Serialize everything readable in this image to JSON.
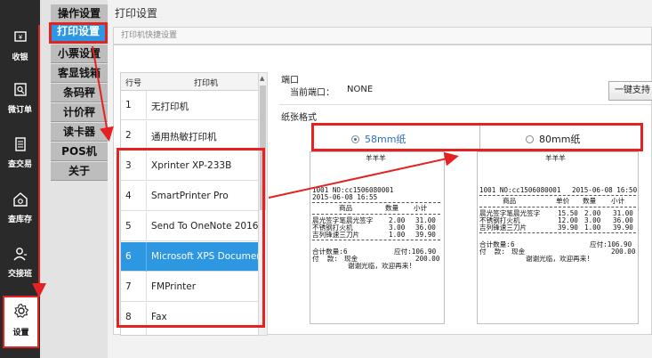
{
  "rail": {
    "items": [
      {
        "label": "收银",
        "icon": "cashier-icon"
      },
      {
        "label": "微订单",
        "icon": "order-icon"
      },
      {
        "label": "查交易",
        "icon": "transaction-icon"
      },
      {
        "label": "查库存",
        "icon": "inventory-icon"
      },
      {
        "label": "交接班",
        "icon": "shift-icon"
      },
      {
        "label": "设置",
        "icon": "gear-icon"
      }
    ]
  },
  "tabs": [
    "操作设置",
    "打印设置",
    "小票设置",
    "客显钱箱",
    "条码秤",
    "计价秤",
    "读卡器",
    "POS机",
    "关于"
  ],
  "main": {
    "title": "打印设置",
    "section": "打印机快捷设置",
    "table": {
      "col_num": "行号",
      "col_printer": "打印机",
      "rows": [
        {
          "num": "1",
          "name": "无打印机"
        },
        {
          "num": "2",
          "name": "通用热敏打印机"
        },
        {
          "num": "3",
          "name": "Xprinter XP-233B"
        },
        {
          "num": "4",
          "name": "SmartPrinter Pro"
        },
        {
          "num": "5",
          "name": "Send To OneNote 2016"
        },
        {
          "num": "6",
          "name": "Microsoft XPS Document"
        },
        {
          "num": "7",
          "name": "FMPrinter"
        },
        {
          "num": "8",
          "name": "Fax"
        }
      ],
      "selected": 6
    },
    "port": {
      "label": "端口",
      "current_label": "当前端口：",
      "current_value": "NONE",
      "button": "一键支持"
    },
    "paper": {
      "label": "纸张格式",
      "opt58": "58mm纸",
      "opt80": "80mm纸",
      "selected": "58mm"
    },
    "receipt58": {
      "store": "羊羊羊",
      "order_line": "1001 NO:cc1506080001",
      "date": "2015-06-08 16:55",
      "head_goods": "商品",
      "head_qty": "数量",
      "head_sub": "小计",
      "items": [
        {
          "name": "晨光签字笔晨光签字",
          "qty": "2.00",
          "sub": "31.00"
        },
        {
          "name": "不锈钢打火机",
          "qty": "3.00",
          "sub": "36.00"
        },
        {
          "name": "吉列锋速三刀片",
          "qty": "1.00",
          "sub": "39.90"
        }
      ],
      "total_qty": "合计数量:6",
      "payable": "应付:106.90",
      "paid_label": "付  款:",
      "paid_method": "现金",
      "paid_amount": "200.00",
      "thanks": "谢谢光临，欢迎再来!"
    },
    "receipt80": {
      "store": "羊羊羊",
      "order_line": "1001 NO:cc1506080001",
      "date": "2015-06-08 16:50",
      "head_goods": "商品",
      "head_price": "单价",
      "head_qty": "数量",
      "head_sub": "小计",
      "items": [
        {
          "name": "晨光签字笔晨光签字",
          "price": "15.50",
          "qty": "2.00",
          "sub": "31.00"
        },
        {
          "name": "不锈钢打火机",
          "price": "12.00",
          "qty": "3.00",
          "sub": "36.00"
        },
        {
          "name": "吉列锋速三刀片",
          "price": "39.90",
          "qty": "1.00",
          "sub": "39.90"
        }
      ],
      "total_qty": "合计数量:6",
      "payable": "应付:106.90",
      "paid_label": "付  款:",
      "paid_method": "现金",
      "paid_amount": "200.00",
      "thanks": "谢谢光临，欢迎再来!"
    }
  },
  "colors": {
    "accent": "#2d97e2",
    "highlight": "#e52222",
    "rail": "#2a2a2a"
  }
}
